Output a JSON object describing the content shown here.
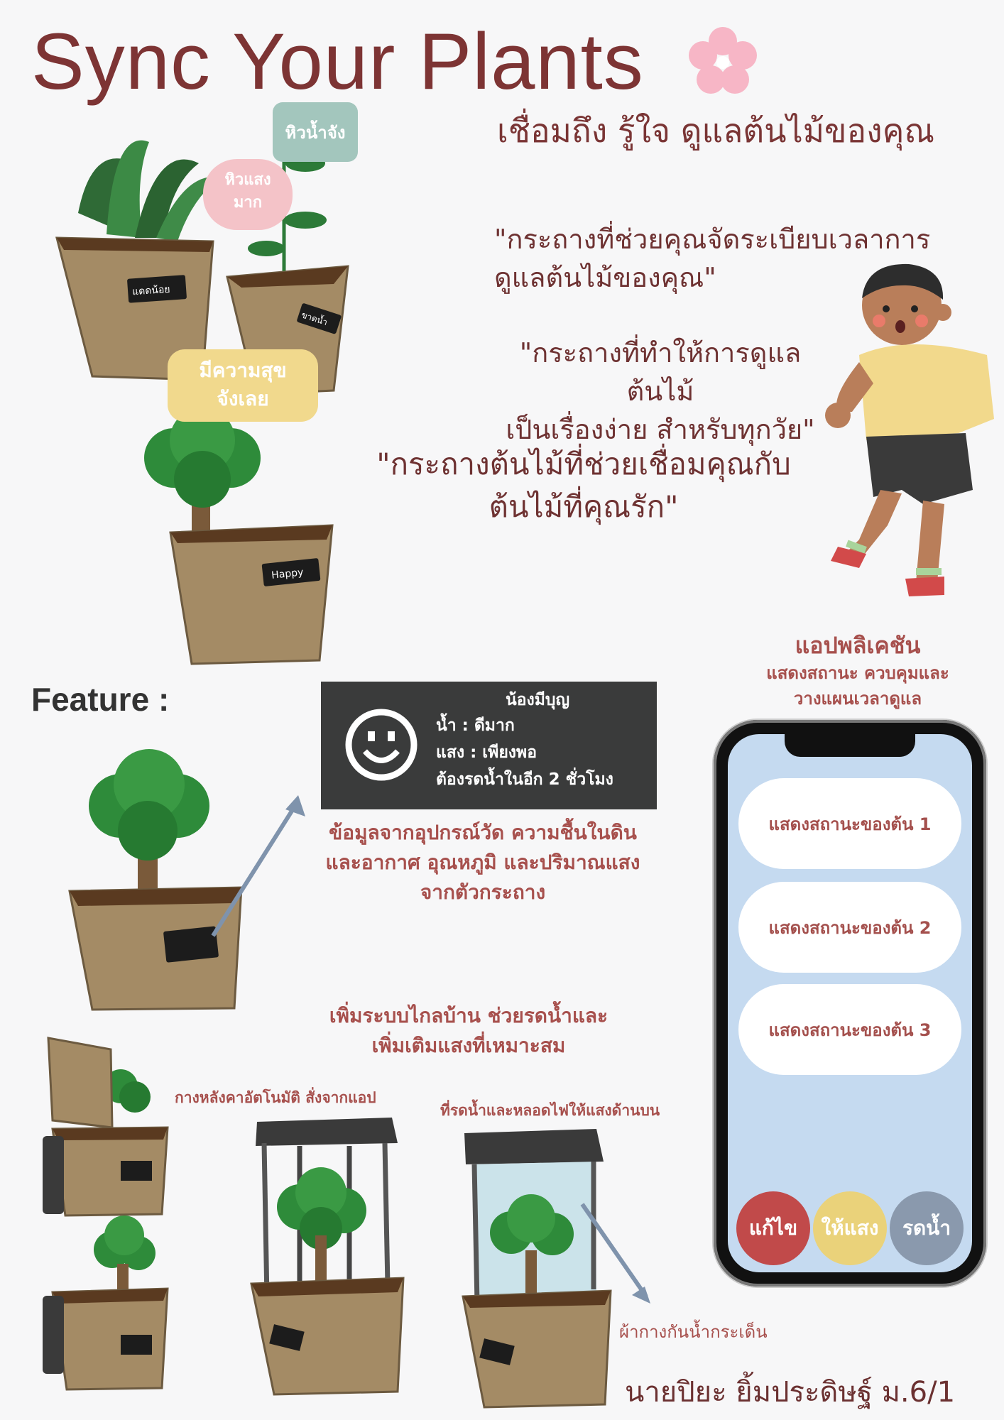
{
  "title": "Sync Your Plants",
  "subtitle": "เชื่อมถึง รู้ใจ ดูแลต้นไม้ของคุณ",
  "bubbles": {
    "thirsty": "หิวน้ำจัง",
    "light_line1": "หิวแสง",
    "light_line2": "มาก",
    "happy_line1": "มีความสุข",
    "happy_line2": "จังเลย"
  },
  "pot_labels": {
    "low_light": "แดดน้อย",
    "need_water": "ขาดน้ำ",
    "happy": "Happy"
  },
  "quotes": {
    "q1_line1": "\"กระถางที่ช่วยคุณจัดระเบียบเวลาการ",
    "q1_line2": "ดูแลต้นไม้ของคุณ\"",
    "q2_line1": "\"กระถางที่ทำให้การดูแลต้นไม้",
    "q2_line2": "เป็นเรื่องง่าย สำหรับทุกวัย\"",
    "q3_line1": "\"กระถางต้นไม้ที่ช่วยเชื่อมคุณกับ",
    "q3_line2": "ต้นไม้ที่คุณรัก\""
  },
  "app_section": {
    "heading": "แอปพลิเคชัน",
    "desc_line1": "แสดงสถานะ ควบคุมและ",
    "desc_line2": "วางแผนเวลาดูแล"
  },
  "feature_label": "Feature :",
  "status_card": {
    "name": "น้องมีบุญ",
    "water": "น้ำ : ดีมาก",
    "light": "แสง : เพียงพอ",
    "next_water": "ต้องรดน้ำในอีก 2 ชั่วโมง"
  },
  "sensor_text": {
    "line1": "ข้อมูลจากอุปกรณ์วัด ความชื้นในดิน",
    "line2": "และอากาศ อุณหภูมิ และปริมาณแสง",
    "line3": "จากตัวกระถาง"
  },
  "remote_text": {
    "line1": "เพิ่มระบบไกลบ้าน ช่วยรดน้ำและ",
    "line2": "เพิ่มเติมแสงที่เหมาะสม"
  },
  "captions": {
    "auto_roof": "กางหลังคาอัตโนมัติ สั่งจากแอป",
    "water_light": "ที่รดน้ำและหลอดไฟให้แสงด้านบน",
    "splash_guard": "ผ้ากางกันน้ำกระเด็น"
  },
  "phone": {
    "plant1": "แสดงสถานะของต้น 1",
    "plant2": "แสดงสถานะของต้น 2",
    "plant3": "แสดงสถานะของต้น 3",
    "btn_edit": "แก้ไข",
    "btn_light": "ให้แสง",
    "btn_water": "รดน้ำ"
  },
  "author": "นายปิยะ ยิ้มประดิษฐ์ ม.6/1",
  "colors": {
    "title": "#7d3434",
    "accent_red": "#a7504d",
    "btn_edit": "#c14a4a",
    "btn_light": "#ead27a",
    "btn_water": "#8a99ad",
    "phone_screen": "#c5daf0",
    "pot": "#a48b65",
    "leaf": "#2e8b3a"
  }
}
